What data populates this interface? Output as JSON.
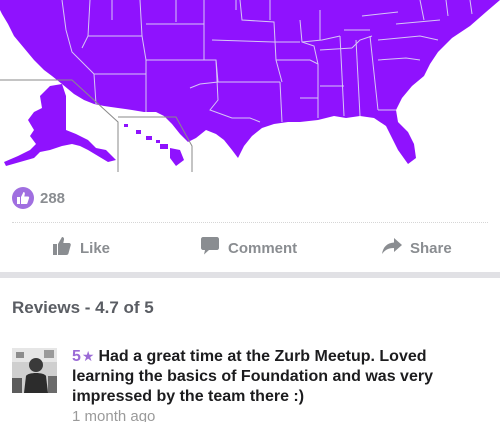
{
  "map": {
    "fill_color": "#8f12fe",
    "border_color": "#d7c6f5",
    "inset_border_color": "#8a8a8a"
  },
  "likes": {
    "count": "288",
    "badge_color": "#a06fe0",
    "icon": "thumbs-up-icon"
  },
  "actions": {
    "like_label": "Like",
    "comment_label": "Comment",
    "share_label": "Share",
    "icons": [
      "thumbs-up-icon",
      "comment-bubble-icon",
      "share-arrow-icon"
    ]
  },
  "reviews": {
    "title": "Reviews - 4.7 of 5",
    "items": [
      {
        "rating": "5",
        "star": "★",
        "text": "Had a great time at the Zurb Meetup. Loved learning the basics of Foundation and was very impressed by the team there :)",
        "time": "1 month ago"
      }
    ]
  },
  "colors": {
    "accent": "#9b6bd6",
    "muted": "#8a8d91",
    "separator": "#e1e1e5"
  }
}
